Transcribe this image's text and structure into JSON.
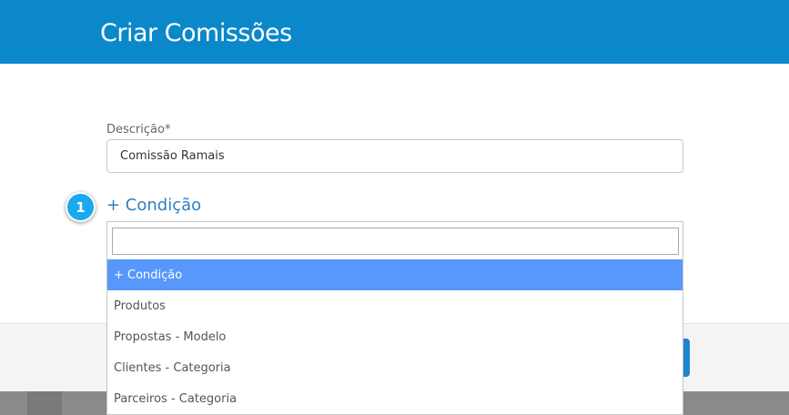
{
  "header": {
    "title": "Criar Comissões"
  },
  "form": {
    "description_label": "Descrição*",
    "description_value": "Comissão Ramais",
    "add_condition_label": "+ Condição",
    "step_number": "1"
  },
  "dropdown": {
    "search_value": "",
    "options": [
      {
        "label": "+ Condição",
        "selected": true
      },
      {
        "label": "Produtos",
        "selected": false
      },
      {
        "label": "Propostas - Modelo",
        "selected": false
      },
      {
        "label": "Clientes - Categoria",
        "selected": false
      },
      {
        "label": "Parceiros - Categoria",
        "selected": false
      }
    ]
  },
  "colors": {
    "header_bg": "#0b88c9",
    "link": "#2f7fc1",
    "highlight": "#5897fb",
    "badge": "#1aa9ee"
  }
}
